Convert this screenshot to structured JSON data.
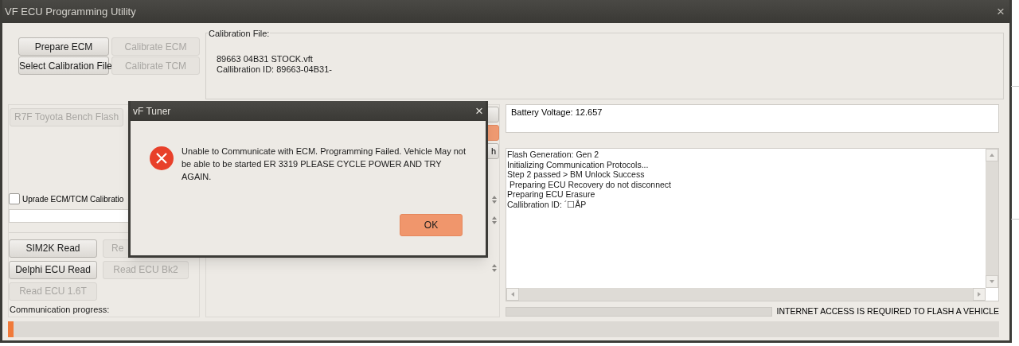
{
  "window": {
    "title": "VF ECU Programming Utility",
    "close": "×"
  },
  "top_buttons": [
    {
      "label": "Prepare ECM",
      "disabled": false
    },
    {
      "label": "Calibrate ECM",
      "disabled": true
    },
    {
      "label": "Select Calibration File",
      "disabled": false
    },
    {
      "label": "Calibrate TCM",
      "disabled": true
    }
  ],
  "calibration_file": {
    "title": "Calibration File:",
    "lines": [
      "89663 04B31 STOCK.vft",
      "Callibration ID: 89663-04B31-"
    ]
  },
  "bench_flash_button": {
    "label": "R7F Toyota Bench Flash",
    "disabled": true
  },
  "upgrade_checkbox": {
    "label": "Uprade ECM/TCM Calibratio",
    "checked": false
  },
  "read_buttons": [
    {
      "label": "SIM2K Read",
      "disabled": false
    },
    {
      "label": "Re",
      "disabled": true
    },
    {
      "label": "Delphi ECU Read",
      "disabled": false
    },
    {
      "label": "Read ECU Bk2",
      "disabled": true
    },
    {
      "label": "Read ECU 1.6T",
      "disabled": true
    }
  ],
  "middle_buttons": [
    {
      "kind": "plain"
    },
    {
      "kind": "accent"
    },
    {
      "label": "h",
      "kind": "plain"
    }
  ],
  "battery": {
    "text": "Battery Voltage: 12.657"
  },
  "log": {
    "lines": [
      "Flash Generation: Gen 2",
      "Initializing Communication Protocols...",
      "Step 2 passed > BM Unlock Success",
      " Preparing ECU Recovery do not disconnect",
      "Preparing ECU Erasure",
      "Callibration ID: ´☐ÅP"
    ]
  },
  "status": {
    "text": "INTERNET ACCESS IS REQUIRED TO FLASH A VEHICLE"
  },
  "communication": {
    "label": "Communication progress:",
    "level": 0.006
  },
  "dialog": {
    "title": "vF Tuner",
    "close": "×",
    "message": "Unable to Communicate with ECM. Programming Failed. Vehicle May not be able to be started ER 3319 PLEASE CYCLE POWER AND TRY AGAIN.",
    "ok": "OK"
  }
}
